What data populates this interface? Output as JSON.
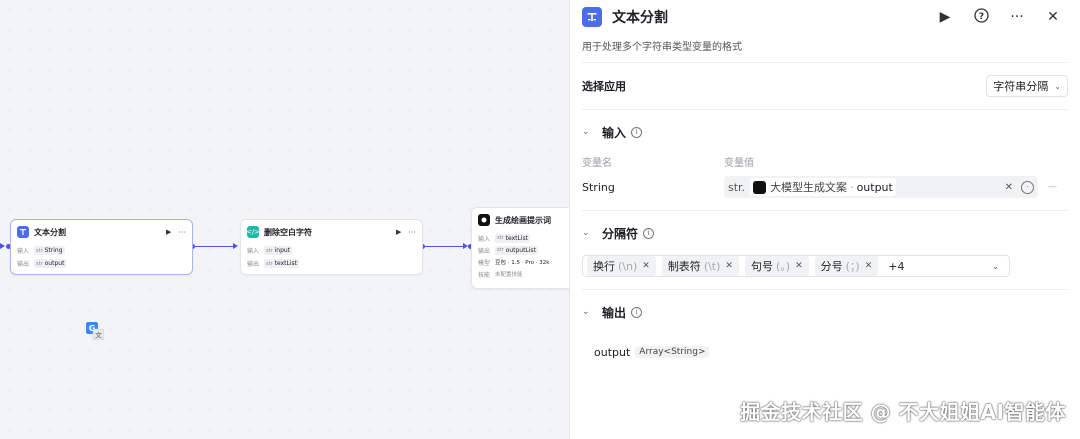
{
  "canvas": {
    "nodes": [
      {
        "title": "文本分割",
        "rows": [
          {
            "key": "输入",
            "tags": [
              {
                "type": "str",
                "label": "String"
              }
            ]
          },
          {
            "key": "输出",
            "tags": [
              {
                "type": "str",
                "label": "output"
              }
            ]
          }
        ]
      },
      {
        "title": "删除空白字符",
        "rows": [
          {
            "key": "输入",
            "tags": [
              {
                "type": "str",
                "label": "input"
              }
            ]
          },
          {
            "key": "输出",
            "tags": [
              {
                "type": "str",
                "label": "textList"
              }
            ]
          }
        ]
      },
      {
        "title": "生成绘画提示词",
        "rows": [
          {
            "key": "输入",
            "tags": [
              {
                "type": "str",
                "label": "textList"
              }
            ]
          },
          {
            "key": "输出",
            "tags": [
              {
                "type": "str",
                "label": "outputList"
              }
            ]
          },
          {
            "key": "模型",
            "text": "豆包 · 1.5 · Pro · 32k"
          },
          {
            "key": "技能",
            "text": "未配置技能"
          }
        ]
      }
    ]
  },
  "panel": {
    "title": "文本分割",
    "description": "用于处理多个字符串类型变量的格式",
    "icons": {
      "run": "play-icon",
      "help": "help-icon",
      "more": "more-icon",
      "close": "close-icon"
    },
    "app": {
      "label": "选择应用",
      "value": "字符串分隔"
    },
    "input": {
      "title": "输入",
      "col_name": "变量名",
      "col_value": "变量值",
      "variable": {
        "name": "String",
        "type": "str.",
        "ref_node": "大模型生成文案",
        "ref_field": "output"
      }
    },
    "separator": {
      "title": "分隔符",
      "chips": [
        {
          "label": "换行",
          "symbol": "(\\n)"
        },
        {
          "label": "制表符",
          "symbol": "(\\t)"
        },
        {
          "label": "句号",
          "symbol": "(。)"
        },
        {
          "label": "分号",
          "symbol": "(；)"
        }
      ],
      "more": "+4"
    },
    "output": {
      "title": "输出",
      "name": "output",
      "type": "Array<String>"
    }
  },
  "watermark": "掘金技术社区 @ 不大姐姐AI智能体",
  "colors": {
    "accent": "#4d53e8",
    "panel_icon": "#4d6de8",
    "code_icon": "#1fb8a6"
  }
}
